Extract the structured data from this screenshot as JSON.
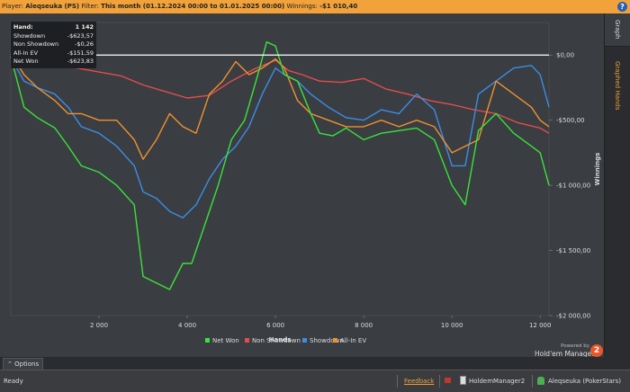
{
  "header": {
    "player_label": "Player:",
    "player_value": "Aleqseuka (PS)",
    "filter_label": "Filter:",
    "filter_value": "This month (01.12.2024 00:00 to 01.01.2025 00:00)",
    "winnings_label": "Winnings:",
    "winnings_value": "-$1 010,40",
    "help_icon": "?"
  },
  "sidebar": {
    "tabs": [
      {
        "label": "Graph",
        "active": true
      },
      {
        "label": "Graphed Hands",
        "active": false
      }
    ]
  },
  "stats_box": {
    "rows": [
      {
        "label": "Hand:",
        "value": "1 142"
      },
      {
        "label": "Showdown",
        "value": "-$623,57"
      },
      {
        "label": "Non Showdown",
        "value": "-$0,26"
      },
      {
        "label": "All-In EV",
        "value": "-$151,59"
      },
      {
        "label": "Net Won",
        "value": "-$623,83"
      }
    ]
  },
  "chart_data": {
    "type": "line",
    "xlabel": "Hands",
    "ylabel": "Winnings",
    "xlim": [
      0,
      12200
    ],
    "ylim": [
      -2000,
      250
    ],
    "x_ticks": [
      2000,
      4000,
      6000,
      8000,
      10000,
      12000
    ],
    "x_tick_labels": [
      "2 000",
      "4 000",
      "6 000",
      "8 000",
      "10 000",
      "12 000"
    ],
    "y_ticks": [
      0,
      -500,
      -1000,
      -1500,
      -2000
    ],
    "y_tick_labels": [
      "$0,00",
      "-$500,00",
      "-$1 000,00",
      "-$1 500,00",
      "-$2 000,00"
    ],
    "legend_position": "bottom",
    "series": [
      {
        "name": "Net Won",
        "color": "#39e33a",
        "x": [
          0,
          300,
          600,
          1000,
          1300,
          1600,
          2000,
          2400,
          2800,
          3000,
          3300,
          3600,
          3900,
          4100,
          4400,
          4700,
          5000,
          5300,
          5600,
          5800,
          6000,
          6200,
          6500,
          6800,
          7000,
          7300,
          7600,
          8000,
          8400,
          8800,
          9200,
          9600,
          10000,
          10300,
          10600,
          11000,
          11400,
          11800,
          12000,
          12200
        ],
        "y": [
          -10,
          -400,
          -480,
          -560,
          -700,
          -850,
          -900,
          -1000,
          -1150,
          -1700,
          -1750,
          -1800,
          -1600,
          -1600,
          -1300,
          -1000,
          -650,
          -500,
          -150,
          100,
          70,
          -150,
          -200,
          -450,
          -600,
          -620,
          -560,
          -650,
          -600,
          -580,
          -560,
          -650,
          -1000,
          -1150,
          -580,
          -450,
          -600,
          -700,
          -750,
          -1000
        ]
      },
      {
        "name": "Non Showdown",
        "color": "#e24d4d",
        "x": [
          0,
          500,
          1000,
          1500,
          2000,
          2500,
          3000,
          3500,
          4000,
          4500,
          5000,
          5500,
          6000,
          6300,
          6600,
          7000,
          7500,
          8000,
          8500,
          9000,
          9500,
          10000,
          10500,
          11000,
          11500,
          12000,
          12200
        ],
        "y": [
          10,
          -40,
          -80,
          -100,
          -130,
          -160,
          -230,
          -280,
          -330,
          -310,
          -200,
          -110,
          -40,
          -120,
          -150,
          -200,
          -210,
          -180,
          -260,
          -300,
          -350,
          -380,
          -420,
          -450,
          -520,
          -560,
          -600
        ]
      },
      {
        "name": "Showdown",
        "color": "#3a8ee6",
        "x": [
          0,
          300,
          600,
          1000,
          1300,
          1600,
          2000,
          2400,
          2800,
          3000,
          3300,
          3600,
          3900,
          4200,
          4500,
          4800,
          5100,
          5400,
          5700,
          6000,
          6200,
          6500,
          6800,
          7200,
          7600,
          8000,
          8400,
          8800,
          9200,
          9600,
          10000,
          10300,
          10600,
          11000,
          11400,
          11800,
          12000,
          12200
        ],
        "y": [
          -20,
          -200,
          -250,
          -300,
          -400,
          -550,
          -600,
          -700,
          -850,
          -1050,
          -1100,
          -1200,
          -1250,
          -1150,
          -950,
          -800,
          -700,
          -550,
          -300,
          -100,
          -150,
          -200,
          -300,
          -400,
          -480,
          -500,
          -420,
          -450,
          -300,
          -420,
          -850,
          -850,
          -300,
          -200,
          -100,
          -80,
          -150,
          -400
        ]
      },
      {
        "name": "All-In EV",
        "color": "#f0922e",
        "x": [
          0,
          300,
          600,
          1000,
          1300,
          1600,
          2000,
          2400,
          2800,
          3000,
          3300,
          3600,
          3900,
          4200,
          4500,
          4800,
          5100,
          5400,
          5700,
          6000,
          6200,
          6500,
          6800,
          7200,
          7600,
          8000,
          8400,
          8800,
          9200,
          9600,
          10000,
          10300,
          10600,
          11000,
          11400,
          11800,
          12000,
          12200
        ],
        "y": [
          10,
          -150,
          -250,
          -350,
          -450,
          -450,
          -500,
          -500,
          -650,
          -800,
          -650,
          -450,
          -550,
          -600,
          -300,
          -200,
          -50,
          -150,
          -100,
          -30,
          -100,
          -350,
          -450,
          -500,
          -550,
          -550,
          -500,
          -550,
          -500,
          -550,
          -750,
          -700,
          -650,
          -200,
          -300,
          -400,
          -500,
          -550
        ]
      }
    ]
  },
  "options_label": "Options",
  "branding": {
    "powered_by": "Powered by",
    "product": "Hold'em Manager",
    "badge": "2"
  },
  "status": {
    "ready": "Ready",
    "feedback": "Feedback",
    "app": "HoldemManager2",
    "account": "Aleqseuka (PokerStars)"
  }
}
